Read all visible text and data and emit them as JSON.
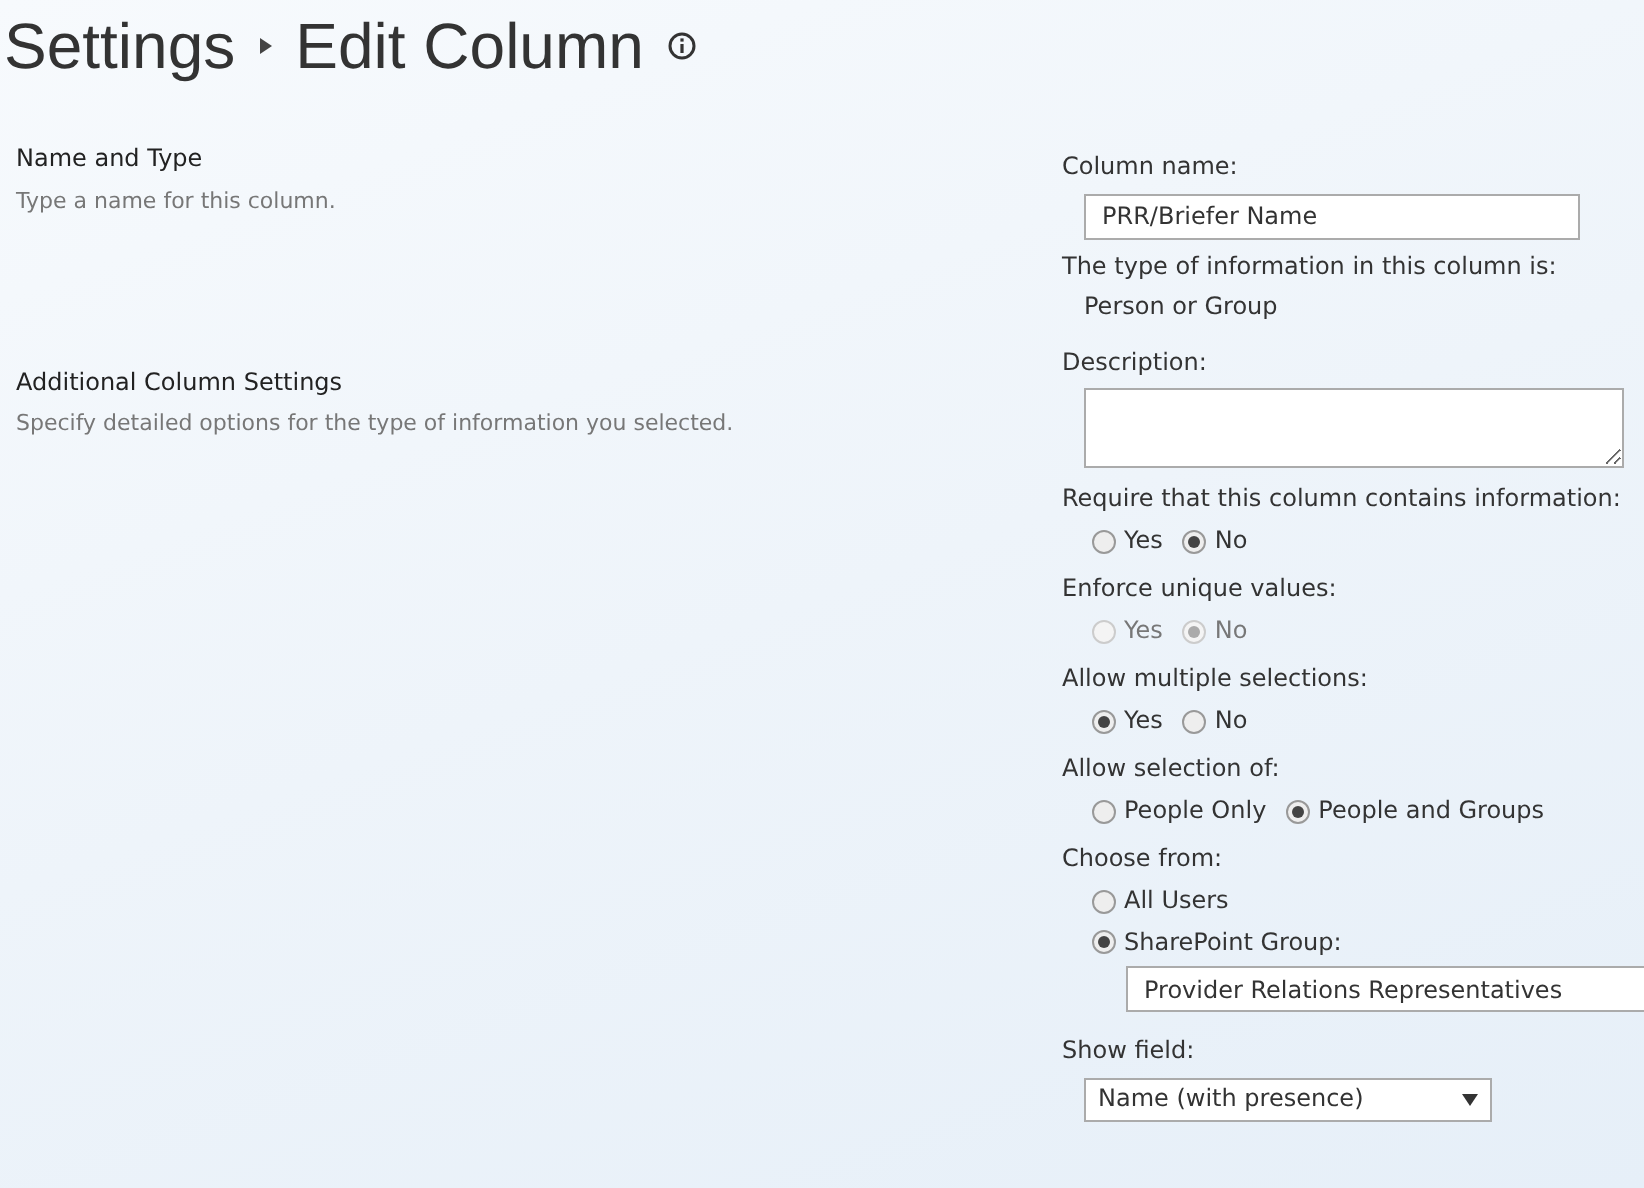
{
  "title": {
    "parent": "Settings",
    "current": "Edit Column"
  },
  "sections": [
    {
      "heading": "Name and Type",
      "description": "Type a name for this column.",
      "fields": [
        {
          "kind": "text",
          "label": "Column name:",
          "value": "PRR/Briefer Name"
        },
        {
          "kind": "static",
          "label": "The type of information in this column is:",
          "value": "Person or Group"
        }
      ]
    },
    {
      "heading": "Additional Column Settings",
      "description": "Specify detailed options for the type of information you selected.",
      "fields": [
        {
          "kind": "textarea",
          "label": "Description:"
        },
        {
          "kind": "radiorow",
          "label": "Require that this column contains information:",
          "disabled": false,
          "options": [
            {
              "label": "Yes",
              "selected": false
            },
            {
              "label": "No",
              "selected": true
            }
          ]
        },
        {
          "kind": "radiorow",
          "label": "Enforce unique values:",
          "disabled": true,
          "options": [
            {
              "label": "Yes",
              "selected": false
            },
            {
              "label": "No",
              "selected": true
            }
          ]
        },
        {
          "kind": "radiorow",
          "label": "Allow multiple selections:",
          "disabled": false,
          "options": [
            {
              "label": "Yes",
              "selected": true
            },
            {
              "label": "No",
              "selected": false
            }
          ]
        },
        {
          "kind": "radiorow",
          "label": "Allow selection of:",
          "disabled": false,
          "options": [
            {
              "label": "People Only",
              "selected": false
            },
            {
              "label": "People and Groups",
              "selected": true
            }
          ]
        },
        {
          "kind": "radiostack",
          "label": "Choose from:",
          "disabled": false,
          "options": [
            {
              "label": "All Users",
              "selected": false
            },
            {
              "label": "SharePoint Group:",
              "selected": true,
              "value": "Provider Relations Representatives"
            }
          ]
        },
        {
          "kind": "select",
          "label": "Show field:",
          "value": "Name (with presence)"
        }
      ]
    }
  ]
}
